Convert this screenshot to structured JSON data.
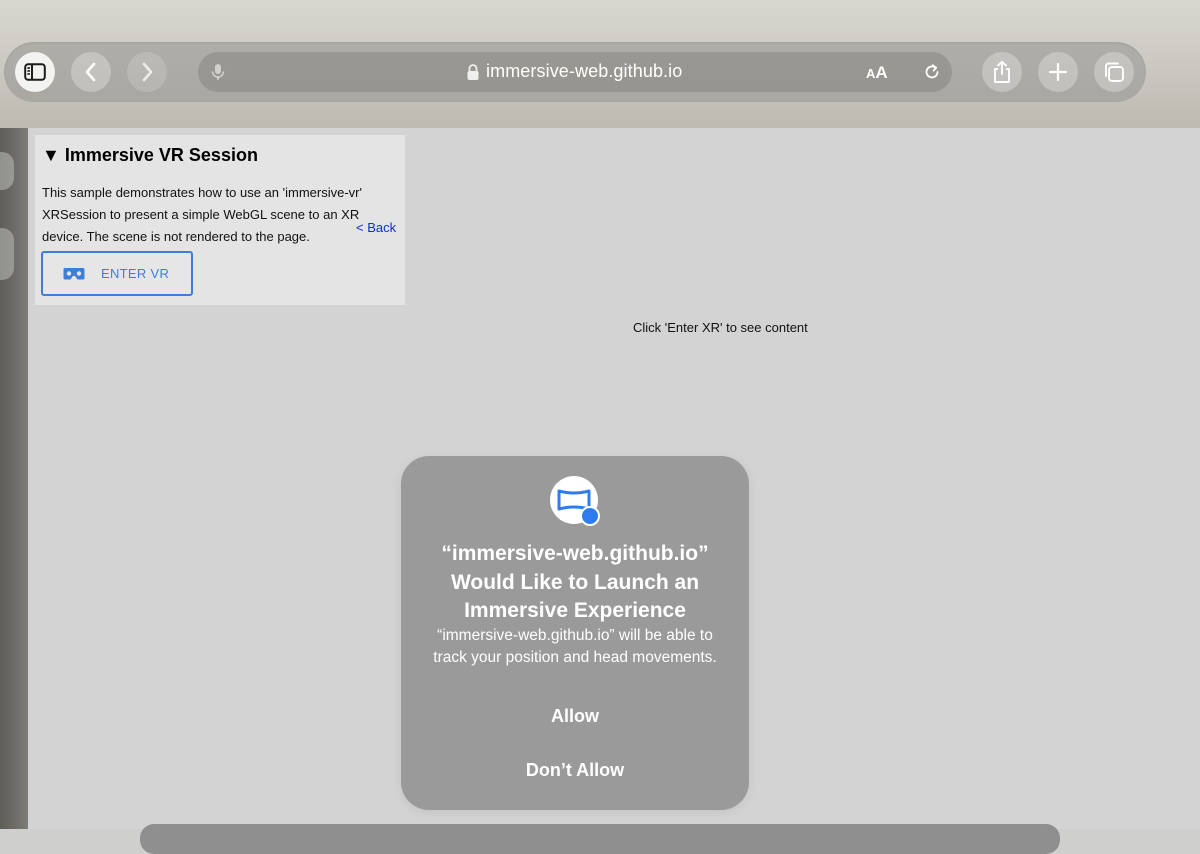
{
  "browser": {
    "url": "immersive-web.github.io",
    "text_size_label": "AA"
  },
  "page": {
    "section_title": "Immersive VR Session",
    "description_lines": [
      "This sample demonstrates how to use an 'immersive-vr'",
      "XRSession to present a simple WebGL scene to an XR",
      "device. The scene is not rendered to the page."
    ],
    "back_link": "< Back",
    "enter_vr_label": "ENTER VR",
    "hint": "Click 'Enter XR' to see content"
  },
  "dialog": {
    "title_lines": [
      "“immersive-web.github.io”",
      "Would Like to Launch an",
      "Immersive Experience"
    ],
    "message_lines": [
      "“immersive-web.github.io” will be able to",
      "track your position and head movements."
    ],
    "allow_label": "Allow",
    "deny_label": "Don’t Allow"
  },
  "colors": {
    "link": "#0a2fd8",
    "enter_vr_accent": "#3f7ed8",
    "dialog_bg": "#969696",
    "badge": "#2f7cf0"
  },
  "icons": {
    "toolbar": [
      "sidebar-icon",
      "back-arrow-icon",
      "forward-arrow-icon",
      "microphone-icon",
      "lock-icon",
      "reload-icon",
      "share-icon",
      "plus-icon",
      "tabs-icon"
    ],
    "enter_vr": "vr-headset-icon",
    "dialog": "immersive-app-icon"
  }
}
